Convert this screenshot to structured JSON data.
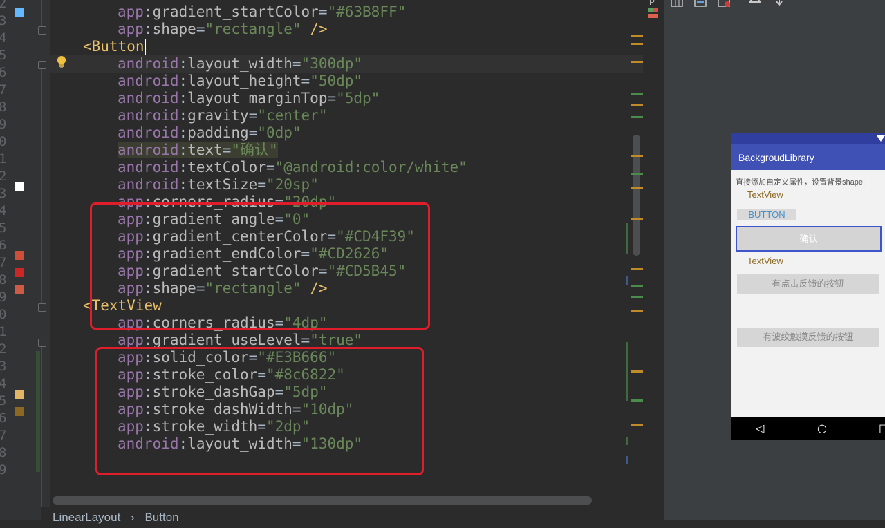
{
  "gutter": {
    "line_numbers": [
      "2",
      "3",
      "4",
      "5",
      "6",
      "7",
      "8",
      "9",
      "0",
      "1",
      "2",
      "3",
      "4",
      "5",
      "6",
      "7",
      "8",
      "9",
      "0",
      "1",
      "2",
      "3",
      "4",
      "5",
      "6",
      "7",
      "8",
      "9"
    ],
    "color_swatches": {
      "top": "#63B8FF",
      "white": "#FFFFFF",
      "center": "#CD4F39",
      "end": "#CD2626",
      "start": "#CD5B45",
      "solid": "#E3B666",
      "stroke": "#8c6822"
    }
  },
  "code": {
    "lines": [
      {
        "indent": "    ",
        "ns": "app",
        "attr": "gradient_startColor",
        "val": "\"#63B8FF\"",
        "tail": ""
      },
      {
        "indent": "    ",
        "ns": "app",
        "attr": "shape",
        "val": "\"rectangle\"",
        "tail": " />"
      },
      {
        "tag": "<Button"
      },
      {
        "indent": "    ",
        "ns": "android",
        "attr": "layout_width",
        "val": "\"300dp\"",
        "tail": ""
      },
      {
        "indent": "    ",
        "ns": "android",
        "attr": "layout_height",
        "val": "\"50dp\"",
        "tail": ""
      },
      {
        "indent": "    ",
        "ns": "android",
        "attr": "layout_marginTop",
        "val": "\"5dp\"",
        "tail": ""
      },
      {
        "indent": "    ",
        "ns": "android",
        "attr": "gravity",
        "val": "\"center\"",
        "tail": ""
      },
      {
        "indent": "    ",
        "ns": "android",
        "attr": "padding",
        "val": "\"0dp\"",
        "tail": ""
      },
      {
        "indent": "    ",
        "ns": "android",
        "attr": "text",
        "val": "\"确认\"",
        "tail": ""
      },
      {
        "indent": "    ",
        "ns": "android",
        "attr": "textColor",
        "val": "\"@android:color/white\"",
        "tail": ""
      },
      {
        "indent": "    ",
        "ns": "android",
        "attr": "textSize",
        "val": "\"20sp\"",
        "tail": ""
      },
      {
        "indent": "    ",
        "ns": "app",
        "attr": "corners_radius",
        "val": "\"20dp\"",
        "tail": ""
      },
      {
        "indent": "    ",
        "ns": "app",
        "attr": "gradient_angle",
        "val": "\"0\"",
        "tail": ""
      },
      {
        "indent": "    ",
        "ns": "app",
        "attr": "gradient_centerColor",
        "val": "\"#CD4F39\"",
        "tail": ""
      },
      {
        "indent": "    ",
        "ns": "app",
        "attr": "gradient_endColor",
        "val": "\"#CD2626\"",
        "tail": ""
      },
      {
        "indent": "    ",
        "ns": "app",
        "attr": "gradient_startColor",
        "val": "\"#CD5B45\"",
        "tail": ""
      },
      {
        "indent": "    ",
        "ns": "app",
        "attr": "shape",
        "val": "\"rectangle\"",
        "tail": " />"
      },
      {
        "tag": "<TextView"
      },
      {
        "indent": "    ",
        "ns": "app",
        "attr": "corners_radius",
        "val": "\"4dp\"",
        "tail": ""
      },
      {
        "indent": "    ",
        "ns": "app",
        "attr": "gradient_useLevel",
        "val": "\"true\"",
        "tail": ""
      },
      {
        "indent": "    ",
        "ns": "app",
        "attr": "solid_color",
        "val": "\"#E3B666\"",
        "tail": ""
      },
      {
        "indent": "    ",
        "ns": "app",
        "attr": "stroke_color",
        "val": "\"#8c6822\"",
        "tail": ""
      },
      {
        "indent": "    ",
        "ns": "app",
        "attr": "stroke_dashGap",
        "val": "\"5dp\"",
        "tail": ""
      },
      {
        "indent": "    ",
        "ns": "app",
        "attr": "stroke_dashWidth",
        "val": "\"10dp\"",
        "tail": ""
      },
      {
        "indent": "    ",
        "ns": "app",
        "attr": "stroke_width",
        "val": "\"2dp\"",
        "tail": ""
      },
      {
        "indent": "    ",
        "ns": "android",
        "attr": "layout_width",
        "val": "\"130dp\"",
        "tail": ""
      }
    ],
    "colon": ":",
    "equals": "="
  },
  "breadcrumb": {
    "item1": "LinearLayout",
    "sep": "›",
    "item2": "Button"
  },
  "preview": {
    "app_title": "BackgroudLibrary",
    "hint": "直接添加自定义属性，设置背景shape:",
    "textview1": "TextView",
    "button": "BUTTON",
    "confirm": "确认",
    "textview2": "TextView",
    "feedback_button": "有点击反馈的按钮",
    "ripple_button": "有波纹触摸反馈的按钮",
    "nav_back": "◁",
    "nav_home": "○",
    "nav_recent": "□",
    "toolbar_partial": "P"
  },
  "colors": {
    "tag": "#e8bf6a",
    "namespace": "#9876aa",
    "attribute": "#bababa",
    "value": "#6a8759",
    "highlight_box": "#e01e2b",
    "appbar": "#3f51b5"
  }
}
